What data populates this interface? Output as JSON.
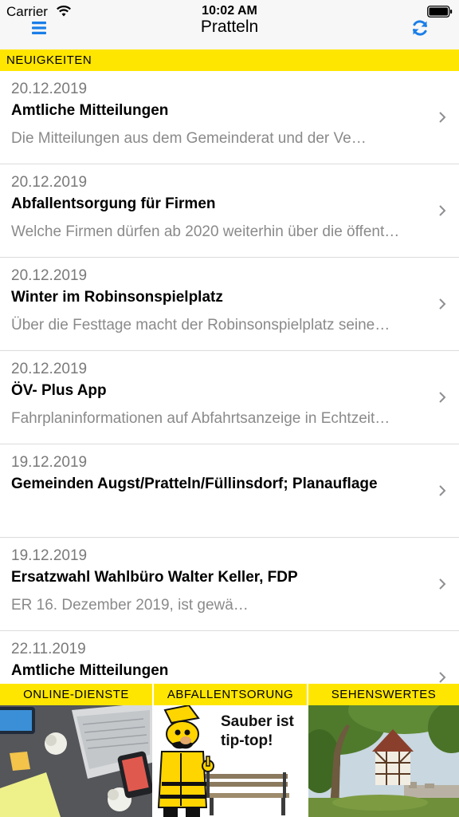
{
  "status_bar": {
    "carrier": "Carrier",
    "time": "10:02 AM"
  },
  "nav": {
    "title": "Pratteln",
    "menu_icon": "hamburger-menu-icon",
    "refresh_icon": "refresh-icon"
  },
  "section": {
    "title": "NEUIGKEITEN"
  },
  "news": [
    {
      "date": "20.12.2019",
      "title": "Amtliche Mitteilungen",
      "desc": "Die Mitteilungen aus dem Gemeinderat und der Ve…"
    },
    {
      "date": "20.12.2019",
      "title": "Abfallentsorgung für Firmen",
      "desc": "Welche Firmen dürfen ab 2020 weiterhin über die öffent…"
    },
    {
      "date": "20.12.2019",
      "title": "Winter im Robinsonspielplatz",
      "desc": "Über die Festtage macht der Robinsonspielplatz seine…"
    },
    {
      "date": "20.12.2019",
      "title": "ÖV- Plus App",
      "desc": "Fahrplaninformationen auf Abfahrtsanzeige in Echtzeit…"
    },
    {
      "date": "19.12.2019",
      "title": "Gemeinden Augst/Pratteln/Füllinsdorf; Planauflage",
      "desc": ""
    },
    {
      "date": "19.12.2019",
      "title": "Ersatzwahl Wahlbüro Walter Keller, FDP",
      "desc": "ER 16. Dezember 2019, ist gewä…"
    },
    {
      "date": "22.11.2019",
      "title": "Amtliche Mitteilungen",
      "desc": ""
    }
  ],
  "tiles": [
    {
      "label": "ONLINE-DIENSTE"
    },
    {
      "label": "ABFALLENTSORUNG",
      "image_text_1": "Sauber ist",
      "image_text_2": "tip-top!"
    },
    {
      "label": "SEHENSWERTES"
    }
  ],
  "colors": {
    "accent_yellow": "#ffe600",
    "ios_blue": "#1a7ee8",
    "bar_bg": "#f7f7f7"
  }
}
